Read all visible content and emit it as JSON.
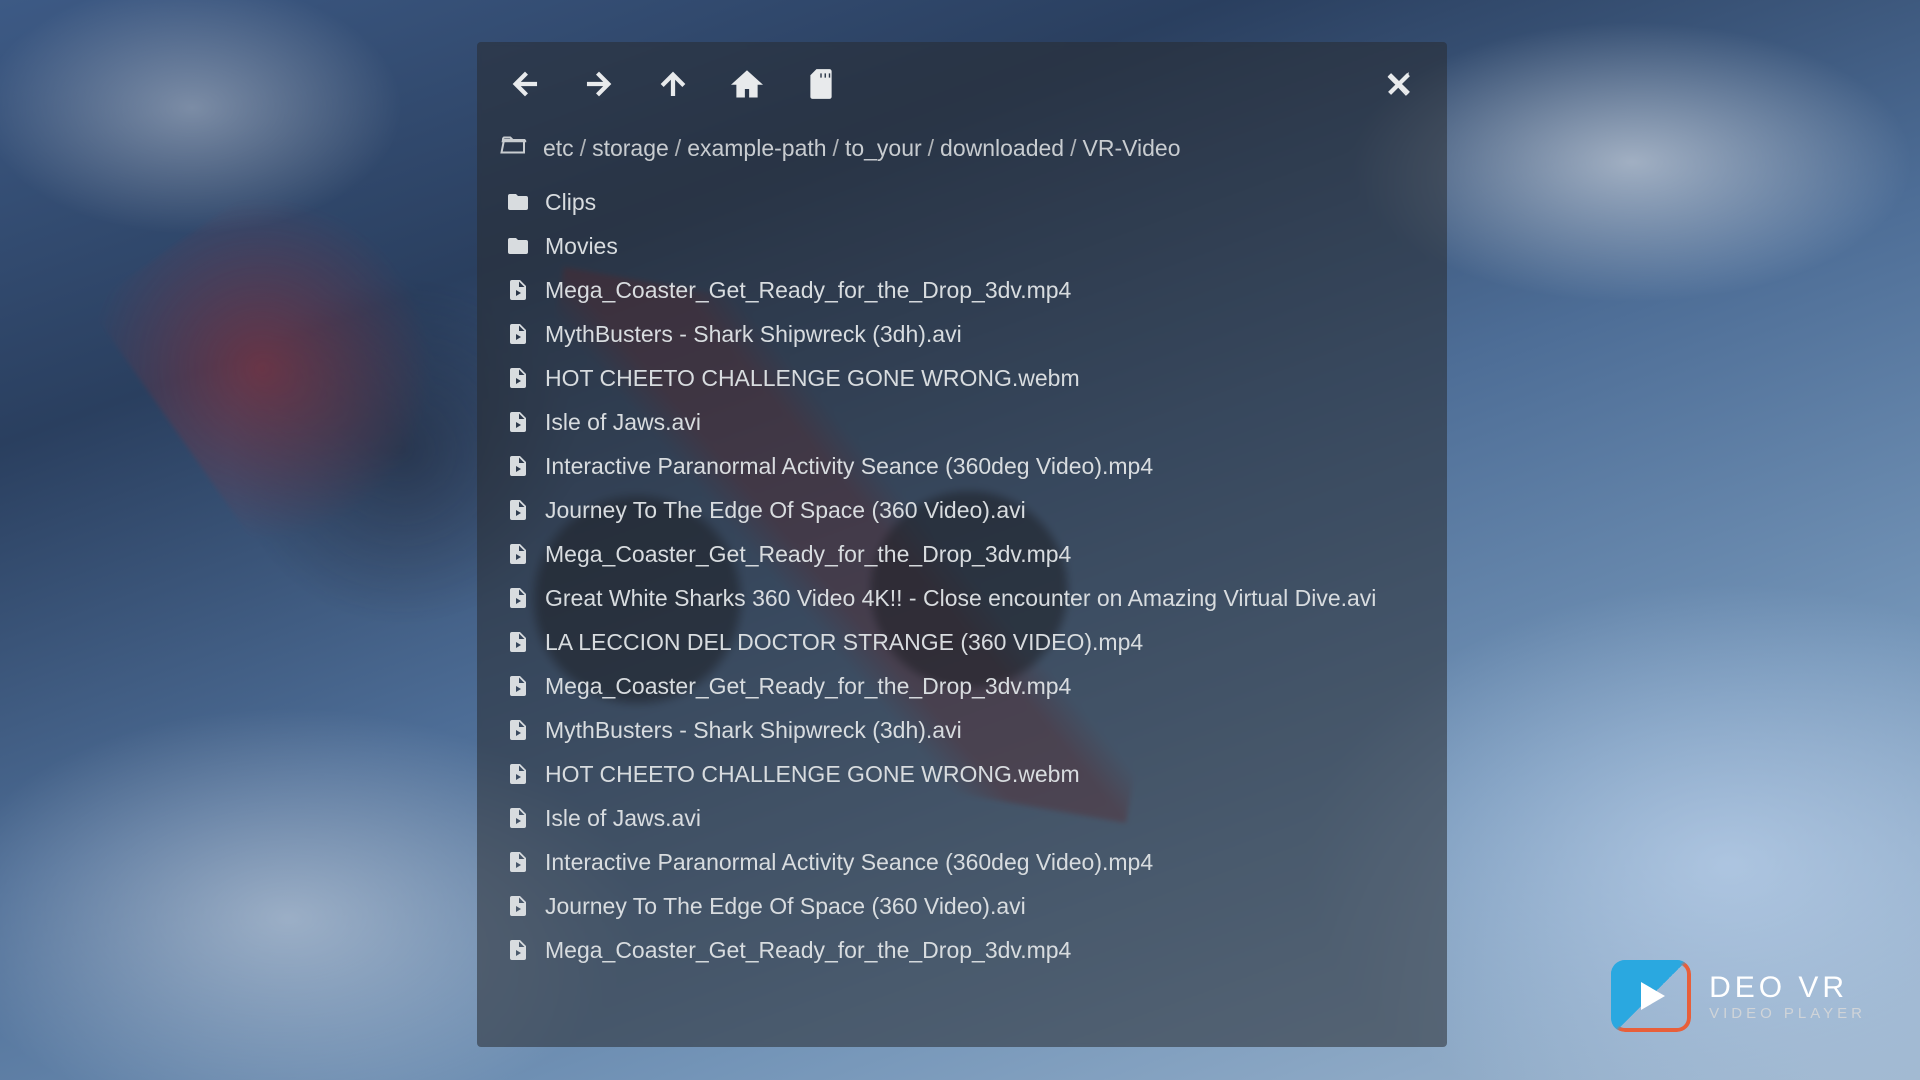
{
  "breadcrumb": [
    "etc",
    "storage",
    "example-path",
    "to_your",
    "downloaded",
    "VR-Video"
  ],
  "items": [
    {
      "type": "folder",
      "name": "Clips"
    },
    {
      "type": "folder",
      "name": "Movies"
    },
    {
      "type": "video",
      "name": "Mega_Coaster_Get_Ready_for_the_Drop_3dv.mp4"
    },
    {
      "type": "video",
      "name": "MythBusters - Shark Shipwreck (3dh).avi"
    },
    {
      "type": "video",
      "name": "HOT CHEETO CHALLENGE GONE WRONG.webm"
    },
    {
      "type": "video",
      "name": "Isle of Jaws.avi"
    },
    {
      "type": "video",
      "name": "Interactive Paranormal Activity Seance (360deg Video).mp4"
    },
    {
      "type": "video",
      "name": "Journey To The Edge Of Space (360 Video).avi"
    },
    {
      "type": "video",
      "name": "Mega_Coaster_Get_Ready_for_the_Drop_3dv.mp4"
    },
    {
      "type": "video",
      "name": "Great White Sharks 360 Video 4K!! - Close encounter on Amazing Virtual Dive.avi"
    },
    {
      "type": "video",
      "name": "LA LECCION DEL DOCTOR STRANGE (360 VIDEO).mp4"
    },
    {
      "type": "video",
      "name": "Mega_Coaster_Get_Ready_for_the_Drop_3dv.mp4"
    },
    {
      "type": "video",
      "name": "MythBusters - Shark Shipwreck (3dh).avi"
    },
    {
      "type": "video",
      "name": "HOT CHEETO CHALLENGE GONE WRONG.webm"
    },
    {
      "type": "video",
      "name": "Isle of Jaws.avi"
    },
    {
      "type": "video",
      "name": "Interactive Paranormal Activity Seance (360deg Video).mp4"
    },
    {
      "type": "video",
      "name": "Journey To The Edge Of Space (360 Video).avi"
    },
    {
      "type": "video",
      "name": "Mega_Coaster_Get_Ready_for_the_Drop_3dv.mp4"
    }
  ],
  "logo": {
    "title": "DEO VR",
    "subtitle": "VIDEO PLAYER"
  }
}
